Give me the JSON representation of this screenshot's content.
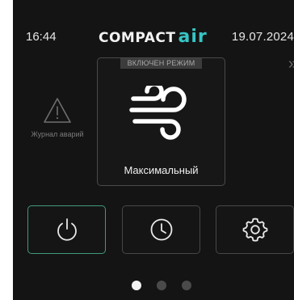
{
  "status_bar": {
    "time": "16:44",
    "date": "19.07.2024",
    "logo_main": "COMPACT",
    "logo_accent": "air"
  },
  "nav": {
    "next_arrow": "»",
    "next_icon": "double-chevron-right-icon"
  },
  "alarm_log": {
    "label": "Журнал аварий",
    "icon": "warning-icon"
  },
  "mode_card": {
    "badge": "ВКЛЮЧЕН РЕЖИМ",
    "label": "Максимальный",
    "icon": "wind-icon"
  },
  "buttons": [
    {
      "id": "power",
      "icon": "power-icon",
      "active": true
    },
    {
      "id": "schedule",
      "icon": "clock-icon",
      "active": false
    },
    {
      "id": "settings",
      "icon": "gear-icon",
      "active": false
    }
  ],
  "pager": {
    "current_page": 1,
    "total_pages": 3
  },
  "colors": {
    "background": "#141414",
    "accent": "#38c4c4",
    "active_border": "#3f9a78",
    "text": "#e6e6e6"
  }
}
